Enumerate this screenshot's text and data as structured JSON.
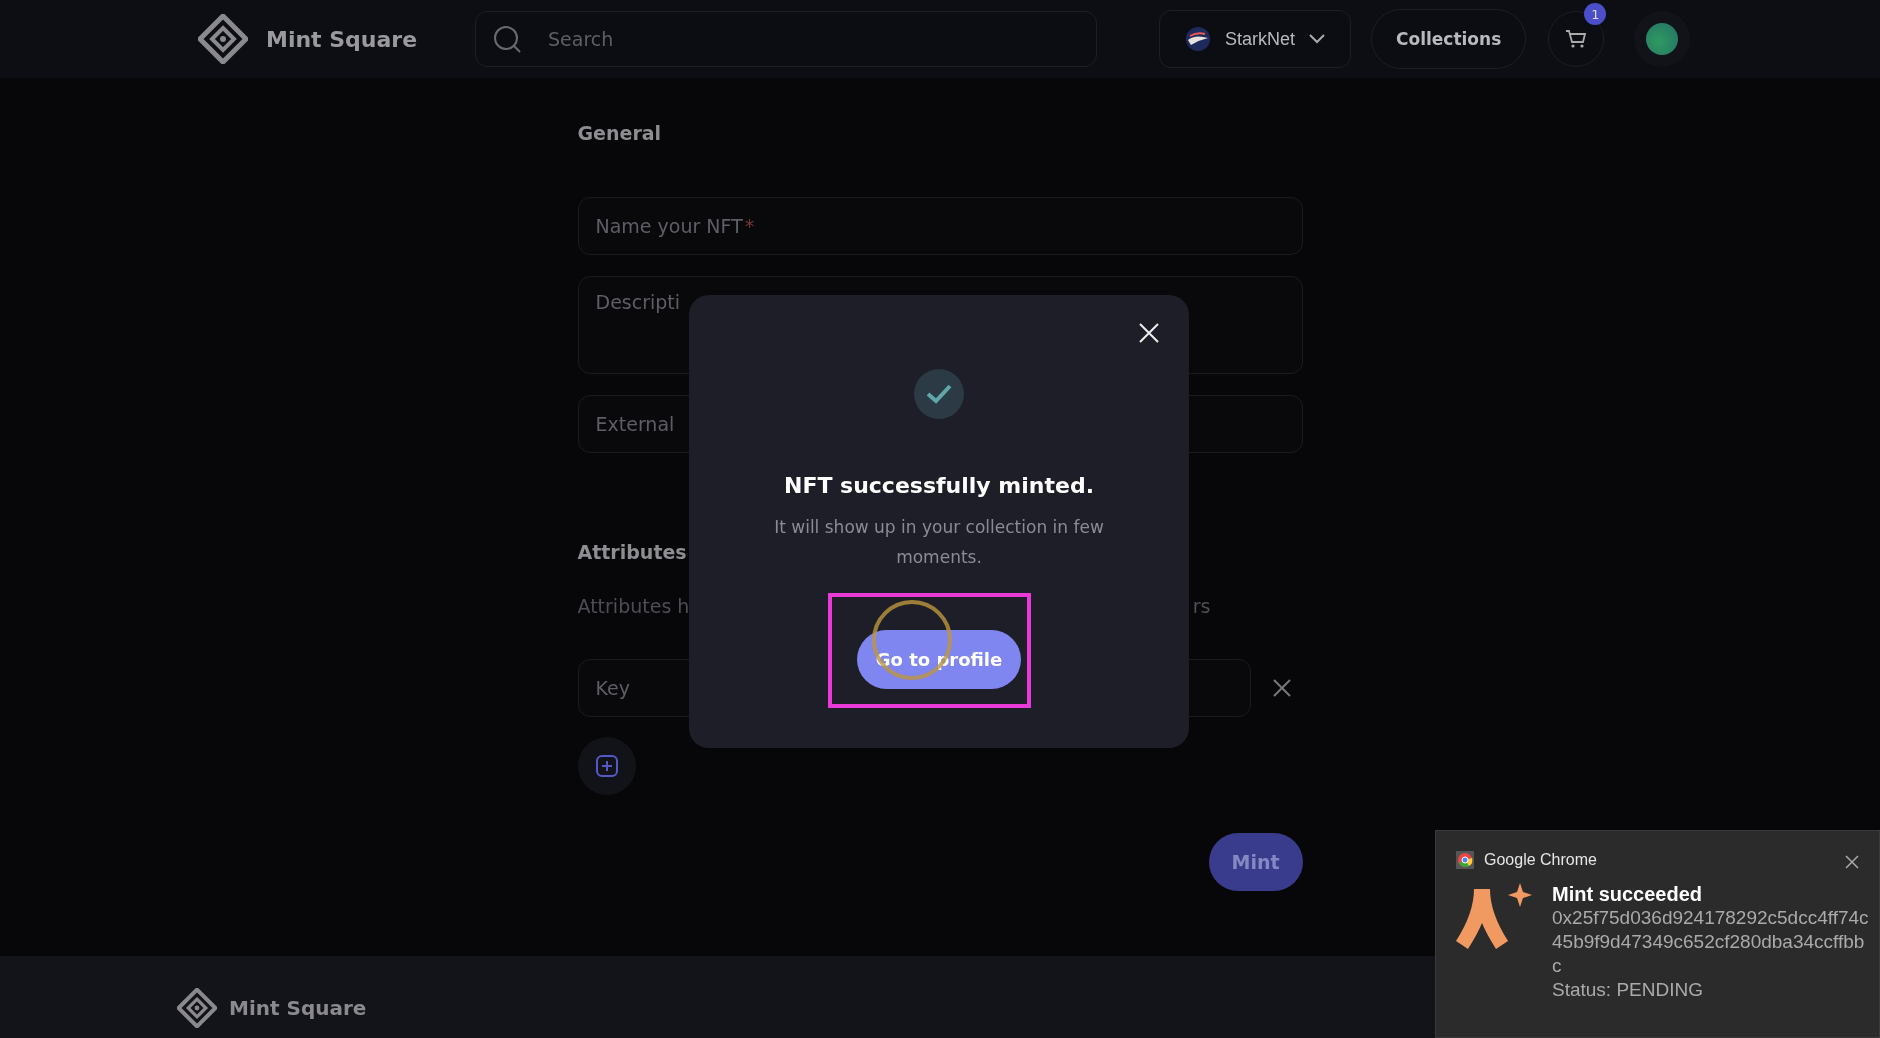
{
  "header": {
    "logo_text": "Mint Square",
    "search": {
      "placeholder": "Search"
    },
    "network": {
      "label": "StarkNet"
    },
    "collections_button": "Collections",
    "cart": {
      "badge": "1"
    }
  },
  "form": {
    "section_title": "General",
    "fields": [
      {
        "kind": "single",
        "placeholder": "Name your NFT",
        "required_mark": "*"
      },
      {
        "kind": "multi",
        "placeholder": "Descripti"
      },
      {
        "kind": "single",
        "placeholder": "External"
      }
    ],
    "attributes": {
      "title": "Attributes",
      "hint_left": "Attributes h",
      "hint_right": "rs",
      "rows": [
        {
          "key_placeholder": "Key"
        }
      ]
    },
    "mint_button": "Mint"
  },
  "footer": {
    "logo_text": "Mint Square"
  },
  "modal": {
    "title": "NFT successfully minted.",
    "message": "It will show up in your collection in few moments.",
    "button": "Go to profile"
  },
  "notification": {
    "app": "Google Chrome",
    "title": "Mint succeeded",
    "hash": "0x25f75d036d924178292c5dcc4ff74c45b9f9d47349c652cf280dba34ccffbbc",
    "status": "Status: PENDING"
  }
}
